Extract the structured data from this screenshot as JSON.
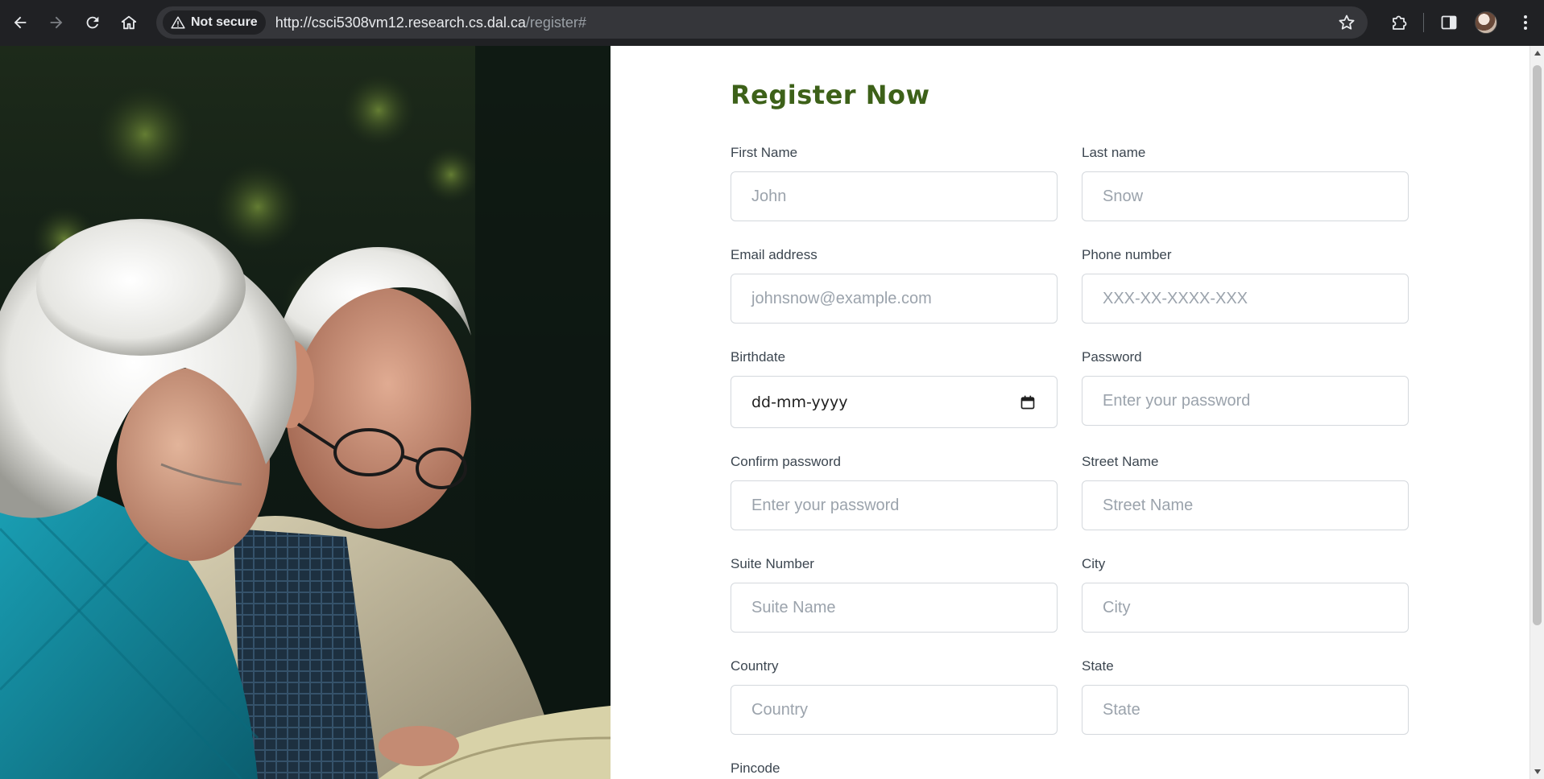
{
  "browser": {
    "security_label": "Not secure",
    "url_host": "http://csci5308vm12.research.cs.dal.ca",
    "url_path": "/register#"
  },
  "page": {
    "title": "Register Now",
    "photo_alt": "Elderly couple reading together"
  },
  "form": {
    "first_name": {
      "label": "First Name",
      "placeholder": "John"
    },
    "last_name": {
      "label": "Last name",
      "placeholder": "Snow"
    },
    "email": {
      "label": "Email address",
      "placeholder": "johnsnow@example.com"
    },
    "phone": {
      "label": "Phone number",
      "placeholder": "XXX-XX-XXXX-XXX"
    },
    "birthdate": {
      "label": "Birthdate",
      "value": "dd-mm-yyyy"
    },
    "password": {
      "label": "Password",
      "placeholder": "Enter your password"
    },
    "confirm_password": {
      "label": "Confirm password",
      "placeholder": "Enter your password"
    },
    "street": {
      "label": "Street Name",
      "placeholder": "Street Name"
    },
    "suite": {
      "label": "Suite Number",
      "placeholder": "Suite Name"
    },
    "city": {
      "label": "City",
      "placeholder": "City"
    },
    "country": {
      "label": "Country",
      "placeholder": "Country"
    },
    "state": {
      "label": "State",
      "placeholder": "State"
    },
    "pincode": {
      "label": "Pincode"
    }
  },
  "colors": {
    "title": "#3d6119",
    "chrome": "#202124",
    "omnibox": "#35363a"
  }
}
